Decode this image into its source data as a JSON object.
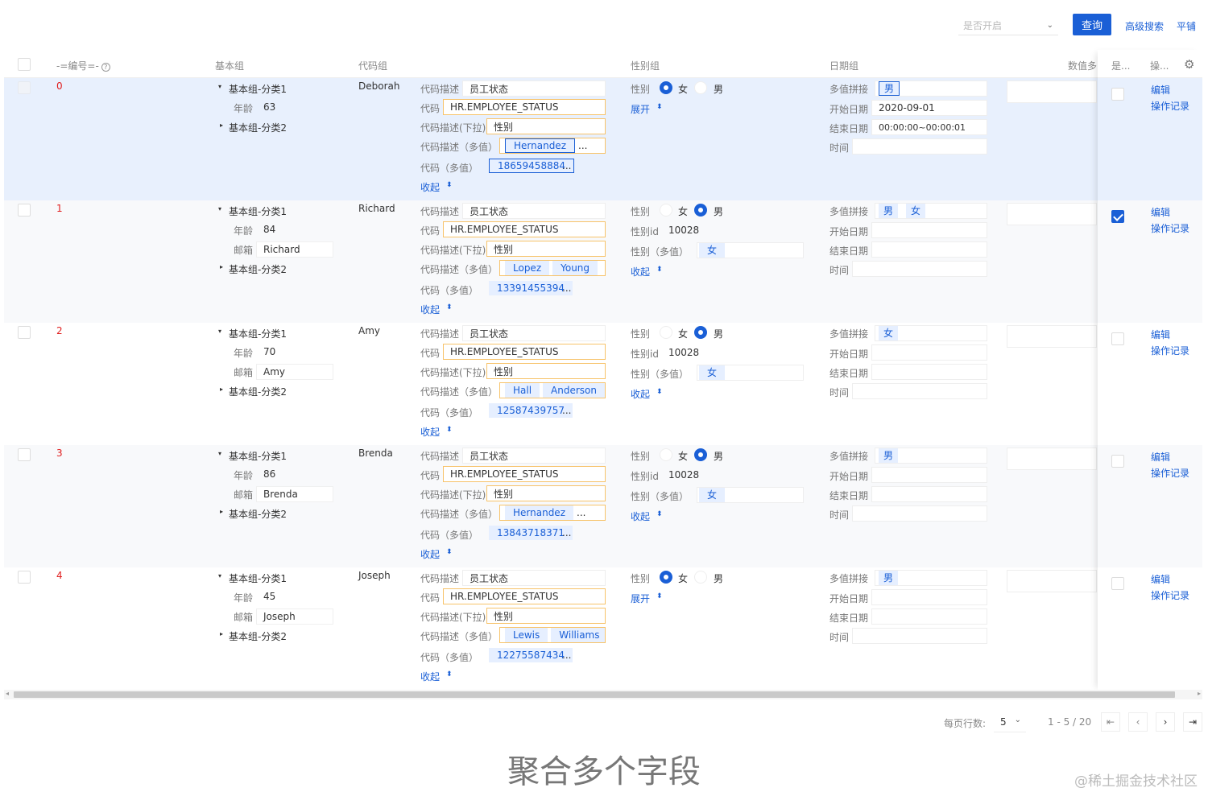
{
  "toolbar": {
    "select_placeholder": "是否开启",
    "query_label": "查询",
    "advanced_search": "高级搜索",
    "tile": "平铺"
  },
  "columns": {
    "id": "-=编号=-",
    "basic": "基本组",
    "code": "代码组",
    "gender": "性别组",
    "date": "日期组",
    "multi": "数值多",
    "yes": "是...",
    "op": "操..."
  },
  "labels": {
    "cat1": "基本组-分类1",
    "cat2": "基本组-分类2",
    "age": "年龄",
    "email": "邮箱",
    "code_desc": "代码描述",
    "code": "代码",
    "code_desc_dd": "代码描述(下拉)",
    "code_desc_multi": "代码描述（多值）",
    "code_multi": "代码（多值）",
    "gender": "性别",
    "gender_id": "性别id",
    "gender_multi": "性别（多值）",
    "female": "女",
    "male": "男",
    "expand": "展开",
    "collapse": "收起",
    "multi_join": "多值拼接",
    "start_date": "开始日期",
    "end_date": "结束日期",
    "time": "时间",
    "edit": "编辑",
    "log": "操作记录",
    "ellipsis": "..."
  },
  "rows": [
    {
      "id": "0",
      "age": "63",
      "email": "",
      "name": "Deborah",
      "code_desc": "员工状态",
      "code": "HR.EMPLOYEE_STATUS",
      "code_dd": "性别",
      "multi_names": [
        "Hernandez"
      ],
      "code_multi": "18659458884",
      "female": true,
      "gender_id": "",
      "gender_multi": "",
      "expanded": false,
      "join_tags": [
        "男"
      ],
      "start": "2020-09-01",
      "end": "00:00:00~00:00:01",
      "checked": false
    },
    {
      "id": "1",
      "age": "84",
      "email": "Richard",
      "name": "Richard",
      "code_desc": "员工状态",
      "code": "HR.EMPLOYEE_STATUS",
      "code_dd": "性别",
      "multi_names": [
        "Lopez",
        "Young"
      ],
      "code_multi": "13391455394",
      "female": false,
      "gender_id": "10028",
      "gender_multi": "女",
      "expanded": true,
      "join_tags": [
        "男",
        "女"
      ],
      "start": "",
      "end": "",
      "checked": true
    },
    {
      "id": "2",
      "age": "70",
      "email": "Amy",
      "name": "Amy",
      "code_desc": "员工状态",
      "code": "HR.EMPLOYEE_STATUS",
      "code_dd": "性别",
      "multi_names": [
        "Hall",
        "Anderson"
      ],
      "code_multi": "12587439757",
      "female": false,
      "gender_id": "10028",
      "gender_multi": "女",
      "expanded": true,
      "join_tags": [
        "女"
      ],
      "start": "",
      "end": "",
      "checked": false
    },
    {
      "id": "3",
      "age": "86",
      "email": "Brenda",
      "name": "Brenda",
      "code_desc": "员工状态",
      "code": "HR.EMPLOYEE_STATUS",
      "code_dd": "性别",
      "multi_names": [
        "Hernandez"
      ],
      "code_multi": "13843718371",
      "female": false,
      "gender_id": "10028",
      "gender_multi": "女",
      "expanded": true,
      "join_tags": [
        "男"
      ],
      "start": "",
      "end": "",
      "checked": false
    },
    {
      "id": "4",
      "age": "45",
      "email": "Joseph",
      "name": "Joseph",
      "code_desc": "员工状态",
      "code": "HR.EMPLOYEE_STATUS",
      "code_dd": "性别",
      "multi_names": [
        "Lewis",
        "Williams"
      ],
      "code_multi": "12275587434",
      "female": true,
      "gender_id": "",
      "gender_multi": "",
      "expanded": false,
      "join_tags": [
        "男"
      ],
      "start": "",
      "end": "",
      "checked": false
    }
  ],
  "pager": {
    "per_page_label": "每页行数:",
    "per_page": "5",
    "range": "1 - 5 / 20"
  },
  "caption": "聚合多个字段",
  "watermark": "@稀土掘金技术社区",
  "colors": {
    "primary": "#1a5fd6",
    "selected_row": "#e8f0fd",
    "tag_bg": "#e6efff",
    "orange_border": "#f7c36a"
  }
}
